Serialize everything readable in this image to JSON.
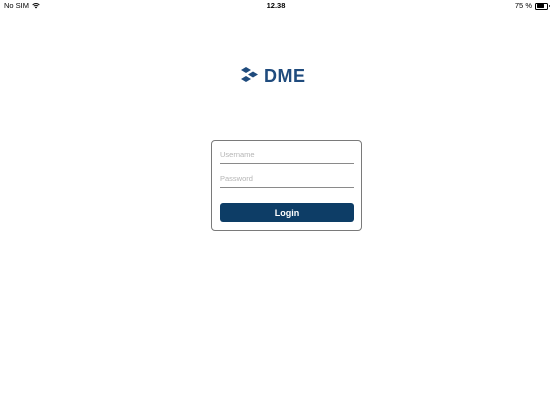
{
  "status_bar": {
    "carrier": "No SIM",
    "time": "12.38",
    "battery_percent_label": "75 %",
    "battery_level": 0.75,
    "wifi_icon": "wifi-icon",
    "battery_icon": "battery-icon"
  },
  "logo": {
    "text": "DME",
    "icon": "dme-logo-mark-icon",
    "color": "#1f4b7d"
  },
  "login_form": {
    "username": {
      "placeholder": "Username",
      "value": ""
    },
    "password": {
      "placeholder": "Password",
      "value": ""
    },
    "login_button_label": "Login",
    "button_color": "#0d3d66"
  }
}
